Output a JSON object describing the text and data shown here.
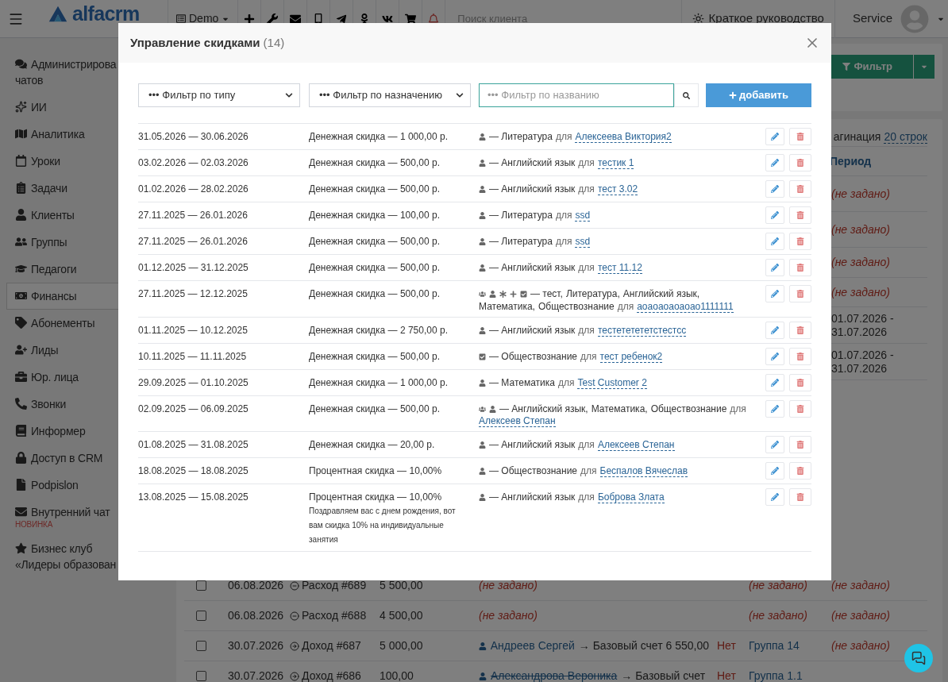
{
  "topbar": {
    "logo": "alfacrm",
    "workspace": "Demo",
    "search": {
      "placeholder": "Поиск клиента"
    },
    "guide": "Краткое руководство",
    "user": "Service"
  },
  "sidebar": {
    "items": [
      {
        "lines": [
          "Администрирова",
          "чатов"
        ],
        "kind": "chats",
        "selected": false
      },
      {
        "lines": [
          "ИИ"
        ],
        "kind": "ai",
        "selected": false
      },
      {
        "lines": [
          "Аналитика"
        ],
        "kind": "analytics",
        "selected": false
      },
      {
        "lines": [
          "Уроки"
        ],
        "kind": "lessons",
        "selected": false
      },
      {
        "lines": [
          "Задачи"
        ],
        "kind": "tasks",
        "selected": false
      },
      {
        "lines": [
          "Клиенты"
        ],
        "kind": "clients",
        "selected": false
      },
      {
        "lines": [
          "Группы"
        ],
        "kind": "groups",
        "selected": false
      },
      {
        "lines": [
          "Педагоги"
        ],
        "kind": "teachers",
        "selected": false
      },
      {
        "lines": [
          "Финансы"
        ],
        "kind": "finance",
        "selected": true
      },
      {
        "lines": [
          "Абонементы"
        ],
        "kind": "subscriptions",
        "selected": false
      },
      {
        "lines": [
          "Лиды"
        ],
        "kind": "leads",
        "selected": false
      },
      {
        "lines": [
          "Юр. лица"
        ],
        "kind": "companies",
        "selected": false
      },
      {
        "lines": [
          "Звонки"
        ],
        "kind": "calls",
        "selected": false
      },
      {
        "lines": [
          "Информер"
        ],
        "kind": "informer",
        "selected": false
      },
      {
        "lines": [
          "Доступ в CRM"
        ],
        "kind": "access",
        "selected": false
      },
      {
        "lines": [
          "Podpislon"
        ],
        "kind": "documents",
        "selected": false
      },
      {
        "lines": [
          "Внутренний чат"
        ],
        "kind": "messages",
        "selected": false,
        "badge": "НОВИНКА"
      },
      {
        "lines": [
          "Бизнес клуб",
          "«Лидеры образован"
        ],
        "kind": "club",
        "selected": false
      }
    ]
  },
  "page": {
    "filter_button": "Фильтр",
    "table": {
      "pagination_label": "агинация",
      "pagination_value": "20 строк",
      "period_header": "Период",
      "upper_periods": [
        "(не задано)",
        "(не задано)",
        "(не задано)",
        "(не задано)",
        "01.07.2026 - 31.07.2026",
        "01.07.2026 - 31.07.2026"
      ],
      "rows": [
        {
          "checked": false,
          "date": "06.08.2026",
          "kind": "expense",
          "type": "Расход #689",
          "amount": "5 500,00",
          "payer": {
            "kind": "unset",
            "text": "(не задано)"
          },
          "group": {
            "kind": "unset",
            "text": "(не задано)"
          },
          "period": "(не задано)"
        },
        {
          "checked": false,
          "date": "06.08.2026",
          "kind": "expense",
          "type": "Расход #688",
          "amount": "4 500,00",
          "payer": {
            "kind": "unset",
            "text": "(не задано)"
          },
          "group": {
            "kind": "unset",
            "text": "(не задано)"
          },
          "period": "(не задано)"
        },
        {
          "checked": false,
          "date": "30.07.2026",
          "kind": "income",
          "type": "Доход #687",
          "amount": "5 000,00",
          "payer": {
            "kind": "client",
            "name": "Андреев Сергей",
            "struck": false,
            "account": "→ Базовый счет 6 550,00"
          },
          "paid": "Нет",
          "group": {
            "kind": "link",
            "text": "Группа 14"
          },
          "period": "(не задано)"
        },
        {
          "checked": false,
          "date": "30.07.2026",
          "kind": "income",
          "type": "Доход #686",
          "amount": "100,00",
          "payer": {
            "kind": "client",
            "name": "Александрова Вероника",
            "struck": true,
            "account": "→ Базовый счет"
          },
          "paid": "Нет",
          "group": {
            "kind": "link",
            "text": "Группа 1.1"
          }
        }
      ]
    }
  },
  "modal": {
    "title": "Управление скидками",
    "count": "(14)",
    "filters": {
      "type": "••• Фильтр по типу",
      "purpose": "••• Фильтр по назначению",
      "name_placeholder": "••• Фильтр по названию"
    },
    "add_button": "добавить",
    "discounts": [
      {
        "period": "31.05.2026 — 30.06.2026",
        "discount": "Денежная скидка — 1 000,00 р.",
        "targets": [
          {
            "kind": "person"
          }
        ],
        "subjects": [
          "— Литература"
        ],
        "for": "для",
        "client": "Алексеева Виктория2"
      },
      {
        "period": "03.02.2026 — 02.03.2026",
        "discount": "Денежная скидка — 500,00 р.",
        "targets": [
          {
            "kind": "person"
          }
        ],
        "subjects": [
          "— Английский язык"
        ],
        "for": "для",
        "client": "тестик 1"
      },
      {
        "period": "01.02.2026 — 28.02.2026",
        "discount": "Денежная скидка — 500,00 р.",
        "targets": [
          {
            "kind": "person"
          }
        ],
        "subjects": [
          "— Английский язык"
        ],
        "for": "для",
        "client": "тест 3.02"
      },
      {
        "period": "27.11.2025 — 26.01.2026",
        "discount": "Денежная скидка — 100,00 р.",
        "targets": [
          {
            "kind": "person"
          }
        ],
        "subjects": [
          "— Литература"
        ],
        "for": "для",
        "client": "ssd"
      },
      {
        "period": "27.11.2025 — 26.01.2026",
        "discount": "Денежная скидка — 500,00 р.",
        "targets": [
          {
            "kind": "person"
          }
        ],
        "subjects": [
          "— Литература"
        ],
        "for": "для",
        "client": "ssd"
      },
      {
        "period": "01.12.2025 — 31.12.2025",
        "discount": "Денежная скидка — 500,00 р.",
        "targets": [
          {
            "kind": "person"
          }
        ],
        "subjects": [
          "— Английский язык"
        ],
        "for": "для",
        "client": "тест 11.12"
      },
      {
        "period": "27.11.2025 — 12.12.2025",
        "discount": "Денежная скидка — 500,00 р.",
        "targets": [
          {
            "kind": "group"
          },
          {
            "kind": "person"
          },
          {
            "kind": "asterisk"
          },
          {
            "kind": "plus"
          },
          {
            "kind": "check"
          }
        ],
        "subjects": [
          "— тест,",
          "Литература,",
          "Английский язык,",
          "Математика,",
          "Обществознание"
        ],
        "for": "для",
        "client": "аоаоаоаоаоао1111111"
      },
      {
        "period": "01.11.2025 — 10.12.2025",
        "discount": "Денежная скидка — 2 750,00 р.",
        "targets": [
          {
            "kind": "person"
          }
        ],
        "subjects": [
          "— Английский язык"
        ],
        "for": "для",
        "client": "тестететететстестсс"
      },
      {
        "period": "10.11.2025 — 11.11.2025",
        "discount": "Денежная скидка — 500,00 р.",
        "targets": [
          {
            "kind": "check"
          }
        ],
        "subjects": [
          "— Обществознание"
        ],
        "for": "для",
        "client": "тест ребенок2"
      },
      {
        "period": "29.09.2025 — 01.10.2025",
        "discount": "Денежная скидка — 1 000,00 р.",
        "targets": [
          {
            "kind": "person"
          }
        ],
        "subjects": [
          "— Математика"
        ],
        "for": "для",
        "client": "Test Customer 2"
      },
      {
        "period": "02.09.2025 — 06.09.2025",
        "discount": "Денежная скидка — 500,00 р.",
        "targets": [
          {
            "kind": "group"
          },
          {
            "kind": "person"
          }
        ],
        "subjects": [
          "— Английский язык,",
          "Математика,",
          "Обществознание"
        ],
        "for": "для",
        "client": "Алексеев Степан"
      },
      {
        "period": "01.08.2025 — 31.08.2025",
        "discount": "Денежная скидка — 20,00 р.",
        "targets": [
          {
            "kind": "person"
          }
        ],
        "subjects": [
          "— Английский язык"
        ],
        "for": "для",
        "client": "Алексеев Степан"
      },
      {
        "period": "18.08.2025 — 18.08.2025",
        "discount": "Процентная скидка — 10,00%",
        "targets": [
          {
            "kind": "person"
          }
        ],
        "subjects": [
          "— Обществознание"
        ],
        "for": "для",
        "client": "Беспалов Вячеслав"
      },
      {
        "period": "13.08.2025 — 15.08.2025",
        "discount": "Процентная скидка — 10,00%",
        "note": "Поздравляем вас с днем рождения, вот вам скидка 10% на индивидуальные занятия",
        "targets": [
          {
            "kind": "person"
          }
        ],
        "subjects": [
          "— Английский язык"
        ],
        "for": "для",
        "client": "Боброва Злата"
      }
    ]
  }
}
